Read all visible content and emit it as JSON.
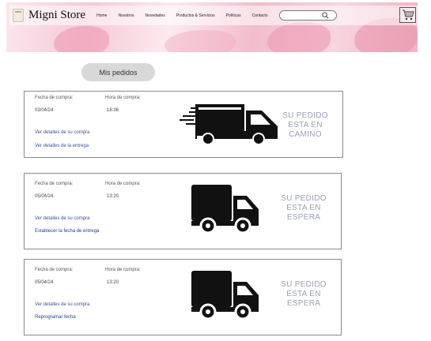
{
  "header": {
    "brand": "Migni Store",
    "nav": [
      "Home",
      "Nosotros",
      "Novedades",
      "Productos & Servicios",
      "Políticas",
      "Contacto"
    ],
    "search": {
      "value": "",
      "placeholder": ""
    },
    "icons": {
      "search": "search-icon",
      "cart": "shopping-cart-icon",
      "logo": "logo-icon"
    }
  },
  "tab": {
    "label": "Mis pedidos"
  },
  "orders": [
    {
      "date_label": "Fecha de compra:",
      "date": "03/04/24",
      "time_label": "Hora de compra:",
      "time": "18:36",
      "link1": "Ver detalles de su compra",
      "link2": "Ver detalles de la entrega",
      "status": [
        "SU PEDIDO",
        "ESTA EN",
        "CAMINO"
      ],
      "icon": "fast-delivery-truck-icon"
    },
    {
      "date_label": "Fecha de compra:",
      "date": "05/04/24",
      "time_label": "Hora de compra:",
      "time": "13:20",
      "link1": "Ver detalles de su compra",
      "link2": "Establecer la fecha de entrega",
      "status": [
        "SU PEDIDO",
        "ESTA EN",
        "ESPERA"
      ],
      "icon": "delivery-truck-icon"
    },
    {
      "date_label": "Fecha de compra:",
      "date": "05/04/24",
      "time_label": "Hora de compra:",
      "time": "13:20",
      "link1": "Ver detalles de su compra",
      "link2": "Reprogramar fecha",
      "status": [
        "SU PEDIDO",
        "ESTA EN",
        "ESPERA"
      ],
      "icon": "delivery-truck-icon"
    }
  ],
  "colors": {
    "accent_pink": "#f3bccc",
    "status_text": "#9aa0b8",
    "link": "#3a4f9a"
  }
}
